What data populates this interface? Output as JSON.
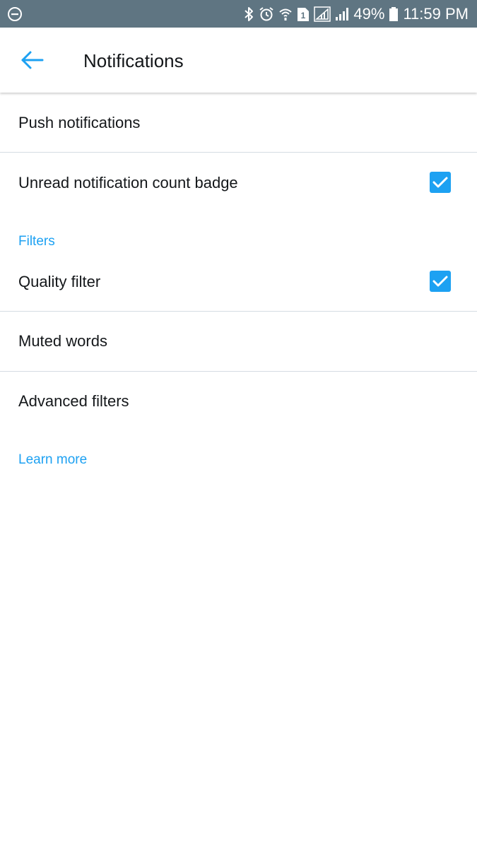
{
  "status_bar": {
    "left_icon": "do-not-disturb-icon",
    "icons": [
      "bluetooth-icon",
      "alarm-icon",
      "wifi-calling-icon",
      "sim-1-icon",
      "signal-icon",
      "signal-icon"
    ],
    "sim_label": "1",
    "battery_percent": "49%",
    "time": "11:59 PM"
  },
  "app_bar": {
    "back_icon": "arrow-left-icon",
    "title": "Notifications"
  },
  "settings": {
    "push_notifications_label": "Push notifications",
    "unread_badge_label": "Unread notification count badge",
    "unread_badge_checked": true,
    "filters_header": "Filters",
    "quality_filter_label": "Quality filter",
    "quality_filter_checked": true,
    "muted_words_label": "Muted words",
    "advanced_filters_label": "Advanced filters",
    "learn_more_label": "Learn more"
  },
  "colors": {
    "accent": "#1da1f2",
    "status_bar": "#5f7582",
    "text_primary": "#14171a",
    "divider": "#d5dce2"
  }
}
